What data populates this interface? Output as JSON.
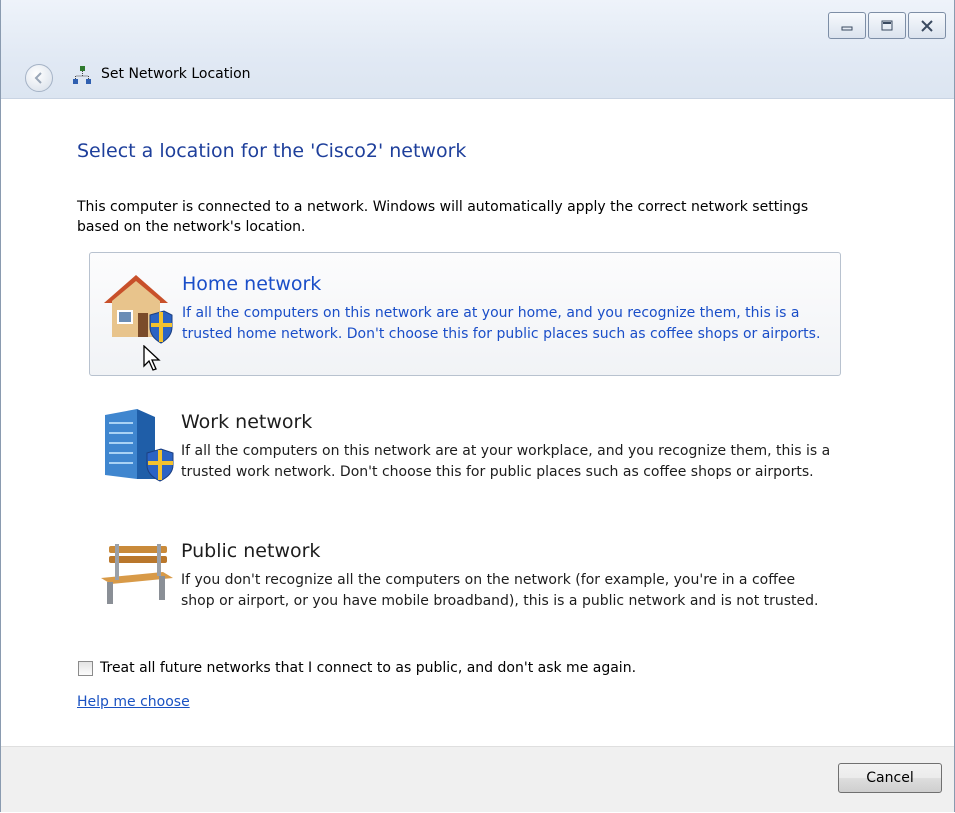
{
  "window": {
    "title": "Set Network Location"
  },
  "main": {
    "heading": "Select a location for the 'Cisco2' network",
    "intro": "This computer is connected to a network. Windows will automatically apply the correct network settings based on the network's location."
  },
  "options": [
    {
      "title": "Home network",
      "description": "If all the computers on this network are at your home, and you recognize them, this is a trusted home network.  Don't choose this for public places such as coffee shops or airports.",
      "icon": "house-shield-icon",
      "selected": true
    },
    {
      "title": "Work network",
      "description": "If all the computers on this network are at your workplace, and you recognize them, this is a trusted work network.  Don't choose this for public places such as coffee shops or airports.",
      "icon": "office-building-shield-icon",
      "selected": false
    },
    {
      "title": "Public network",
      "description": "If you don't recognize all the computers on the network (for example, you're in a coffee shop or airport, or you have mobile broadband), this is a public network and is not trusted.",
      "icon": "park-bench-icon",
      "selected": false
    }
  ],
  "checkbox": {
    "label": "Treat all future networks that I connect to as public, and don't ask me again.",
    "checked": false
  },
  "help_link": "Help me choose",
  "footer": {
    "cancel_label": "Cancel"
  },
  "colors": {
    "heading": "#1e3f9b",
    "selected_text": "#1a4ec8",
    "link": "#1a52c2"
  }
}
